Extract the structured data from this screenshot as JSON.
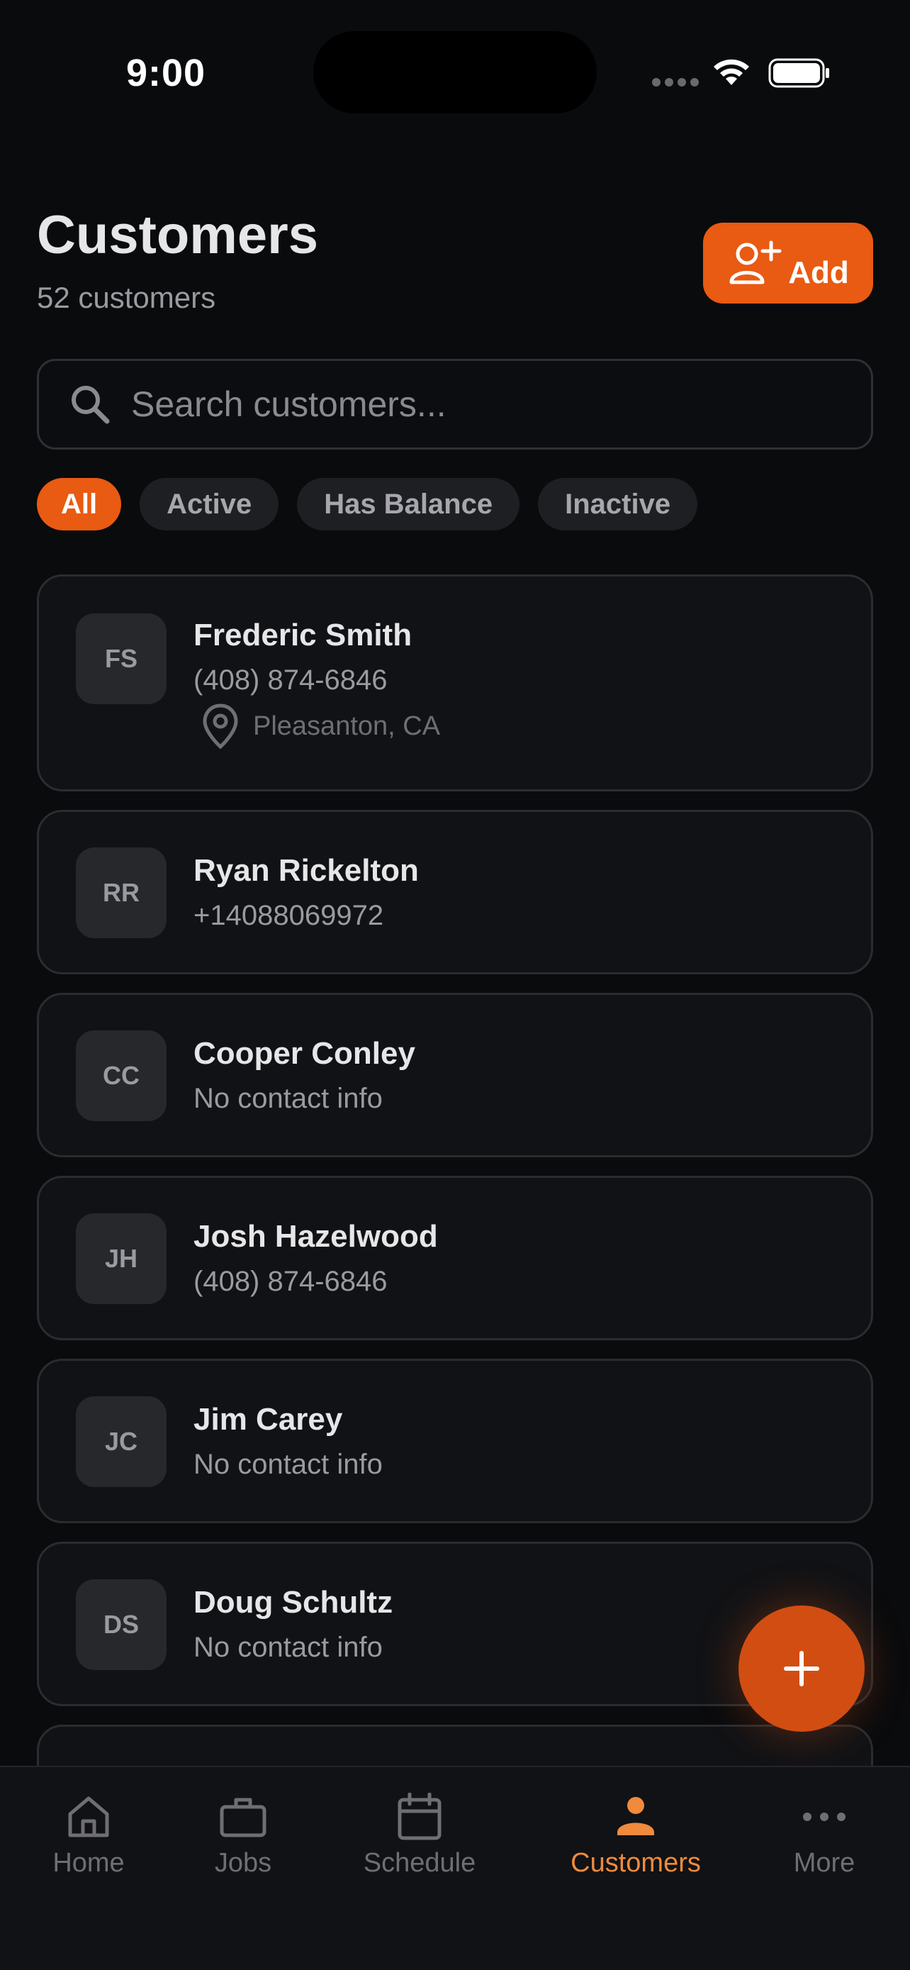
{
  "status_bar": {
    "time": "9:00"
  },
  "header": {
    "title": "Customers",
    "subtitle": "52 customers",
    "add_label": "Add"
  },
  "search": {
    "placeholder": "Search customers..."
  },
  "filters": [
    {
      "label": "All",
      "active": true
    },
    {
      "label": "Active",
      "active": false
    },
    {
      "label": "Has Balance",
      "active": false
    },
    {
      "label": "Inactive",
      "active": false
    }
  ],
  "customers": [
    {
      "initials": "FS",
      "name": "Frederic Smith",
      "contact": "(408) 874-6846",
      "location": "Pleasanton, CA"
    },
    {
      "initials": "RR",
      "name": "Ryan Rickelton",
      "contact": "+14088069972"
    },
    {
      "initials": "CC",
      "name": "Cooper Conley",
      "contact": "No contact info"
    },
    {
      "initials": "JH",
      "name": "Josh Hazelwood",
      "contact": "(408) 874-6846"
    },
    {
      "initials": "JC",
      "name": "Jim Carey",
      "contact": "No contact info"
    },
    {
      "initials": "DS",
      "name": "Doug Schultz",
      "contact": "No contact info"
    }
  ],
  "tabs": [
    {
      "label": "Home",
      "icon": "home-icon"
    },
    {
      "label": "Jobs",
      "icon": "briefcase-icon"
    },
    {
      "label": "Schedule",
      "icon": "calendar-icon"
    },
    {
      "label": "Customers",
      "icon": "person-icon",
      "active": true
    },
    {
      "label": "More",
      "icon": "more-icon"
    }
  ],
  "colors": {
    "accent": "#e95a12",
    "active_tab": "#f08a3c",
    "background": "#0a0b0d"
  }
}
